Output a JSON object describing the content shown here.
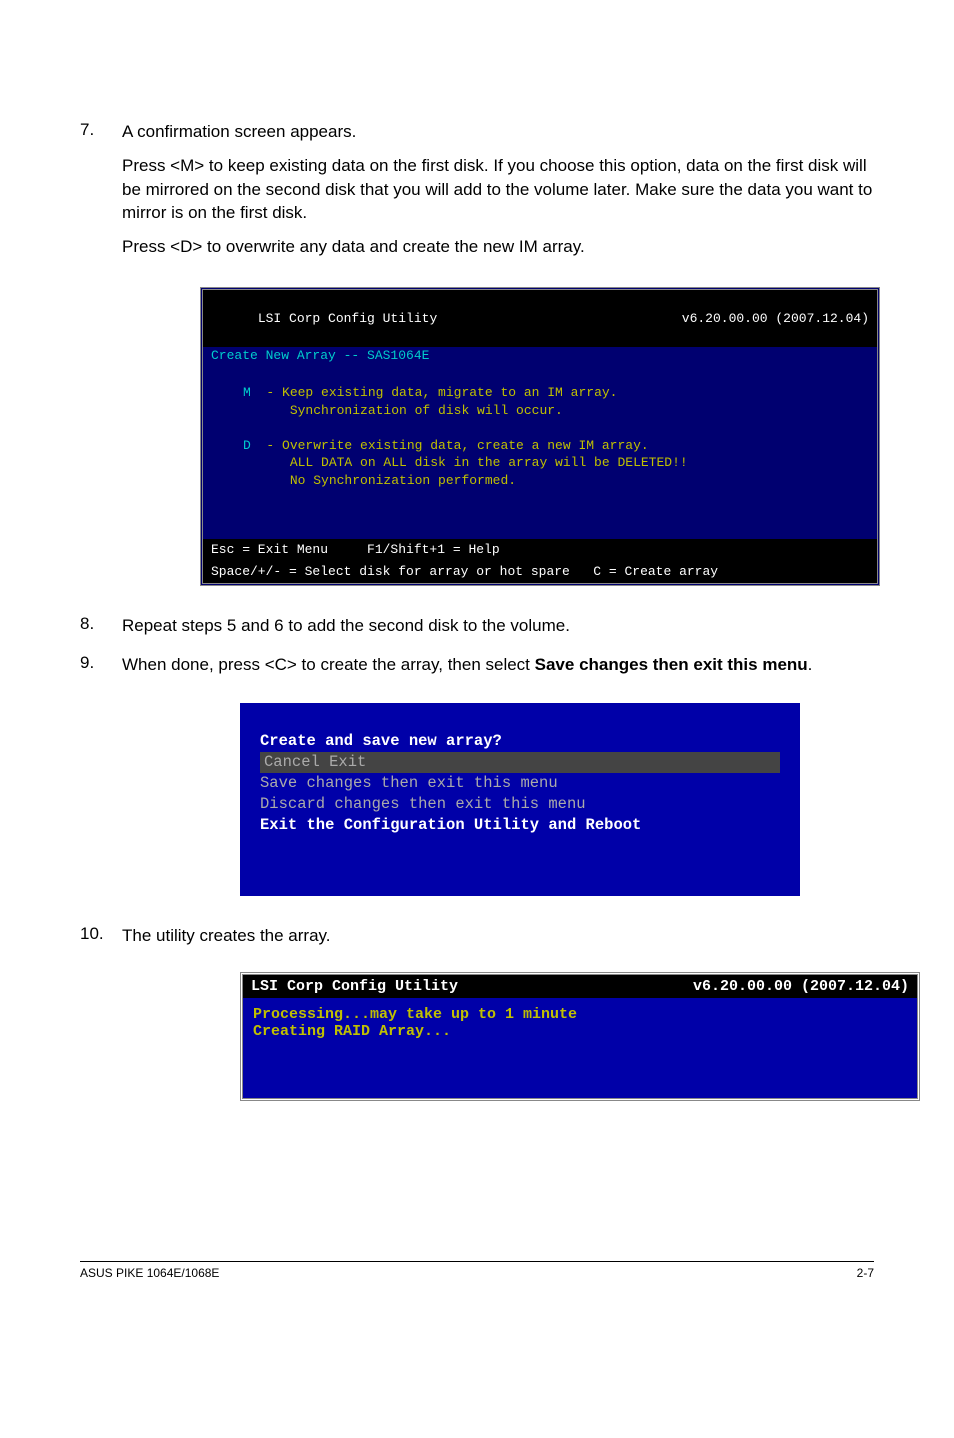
{
  "steps": {
    "s7": {
      "num": "7.",
      "line1": "A confirmation screen appears.",
      "line2": "Press <M> to keep existing data on the first disk. If you choose this option, data on the first disk will be mirrored on the second disk that you will add to the volume later. Make sure the data you want to mirror is on the first disk.",
      "line3": "Press <D> to overwrite any data and create the new IM array."
    },
    "s8": {
      "num": "8.",
      "text": "Repeat steps 5 and 6 to add the second disk to the volume."
    },
    "s9": {
      "num": "9.",
      "prefix": "When done, press <C> to create the array, then select ",
      "bold": "Save changes then exit this menu",
      "suffix": "."
    },
    "s10": {
      "num": "10.",
      "text": "The utility creates the array."
    }
  },
  "bios1": {
    "title": "LSI Corp Config Utility",
    "version": "v6.20.00.00 (2007.12.04)",
    "subtitle": "Create New Array -- SAS1064E",
    "m_key": "M",
    "m_text": "  - Keep existing data, migrate to an IM array.\n      Synchronization of disk will occur.",
    "d_key": "D",
    "d_text": "  - Overwrite existing data, create a new IM array.\n      ALL DATA on ALL disk in the array will be DELETED!!\n      No Synchronization performed.",
    "footer1": "Esc = Exit Menu     F1/Shift+1 = Help",
    "footer2": "Space/+/- = Select disk for array or hot spare   C = Create array"
  },
  "menu": {
    "title": "Create and save new array?",
    "opt1": " Cancel Exit",
    "opt2": " Save changes then exit this menu",
    "opt3": " Discard changes then exit this menu",
    "opt4": " Exit the Configuration Utility and Reboot"
  },
  "bios2": {
    "title": "LSI Corp Config Utility",
    "version": "v6.20.00.00 (2007.12.04)",
    "line1": "Processing...may take up to 1 minute",
    "line2": "Creating RAID Array..."
  },
  "footer": {
    "left": "ASUS PIKE 1064E/1068E",
    "right": "2-7"
  }
}
